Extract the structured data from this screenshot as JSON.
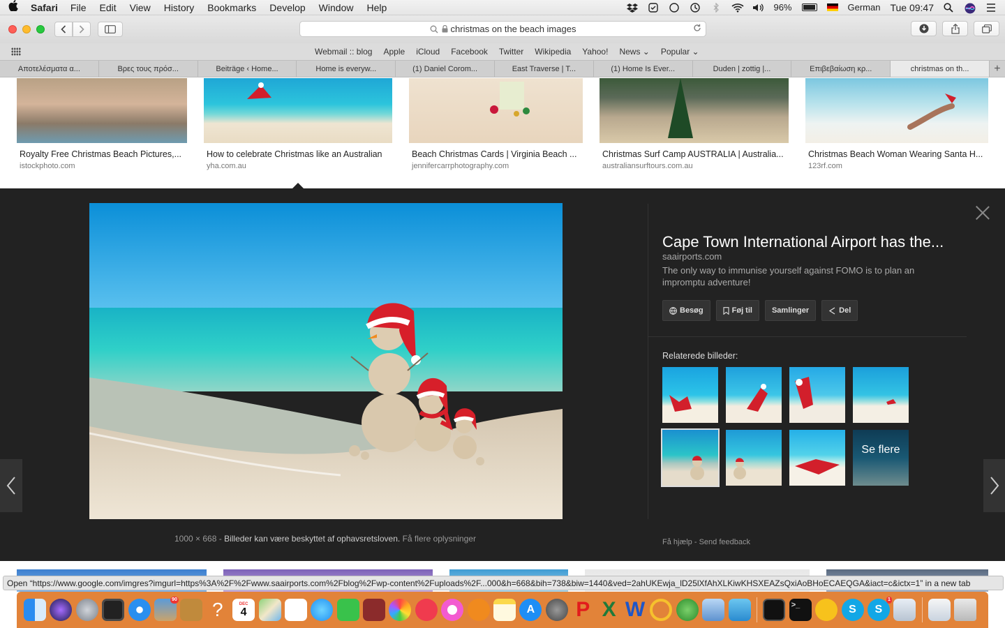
{
  "menubar": {
    "app": "Safari",
    "menus": [
      "File",
      "Edit",
      "View",
      "History",
      "Bookmarks",
      "Develop",
      "Window",
      "Help"
    ],
    "battery": "96%",
    "language": "German",
    "clock": "Tue 09:47"
  },
  "toolbar": {
    "url": "christmas on the beach images"
  },
  "bookmarks": [
    "Webmail :: blog",
    "Apple",
    "iCloud",
    "Facebook",
    "Twitter",
    "Wikipedia",
    "Yahoo!",
    "News ⌄",
    "Popular ⌄"
  ],
  "tabs": [
    "Αποτελέσματα α...",
    "Βρες τους πρόσ...",
    "Beiträge ‹ Home...",
    "Home is everyw...",
    "(1) Daniel Corom...",
    "East Traverse | T...",
    "(1) Home Is Ever...",
    "Duden | zottig |...",
    "Επιβεβαίωση κρ...",
    "christmas on th..."
  ],
  "results": [
    {
      "title": "Royalty Free Christmas Beach Pictures,...",
      "source": "istockphoto.com"
    },
    {
      "title": "How to celebrate Christmas like an Australian",
      "source": "yha.com.au"
    },
    {
      "title": "Beach Christmas Cards | Virginia Beach ...",
      "source": "jennifercarrphotography.com"
    },
    {
      "title": "Christmas Surf Camp AUSTRALIA | Australia...",
      "source": "australiansurftours.com.au"
    },
    {
      "title": "Christmas Beach Woman Wearing Santa H...",
      "source": "123rf.com"
    }
  ],
  "panel": {
    "title": "Cape Town International Airport has the...",
    "source": "saairports.com",
    "description": "The only way to immunise yourself against FOMO is to plan an impromptu adventure!",
    "actions": {
      "visit": "Besøg",
      "save": "Føj til",
      "collections": "Samlinger",
      "share": "Del"
    },
    "related_label": "Relaterede billeder:",
    "see_more": "Se flere",
    "dimensions": "1000 × 668",
    "sep": " - ",
    "copyright": "Billeder kan være beskyttet af ophavsretsloven.",
    "more_info": "Få flere oplysninger",
    "help": "Få hjælp",
    "dot": " - ",
    "feedback": "Send feedback"
  },
  "status": "Open “https://www.google.com/imgres?imgurl=https%3A%2F%2Fwww.saairports.com%2Fblog%2Fwp-content%2Fuploads%2F...000&h=668&bih=738&biw=1440&ved=2ahUKEwja_lD25lXfAhXLKiwKHSXEAZsQxiAoBHoECAEQGA&iact=c&ictx=1” in a new tab",
  "dock": {
    "calendar_day": "4",
    "calendar_month": "DEC",
    "badge_photos": "90",
    "badge_skype": "1"
  }
}
